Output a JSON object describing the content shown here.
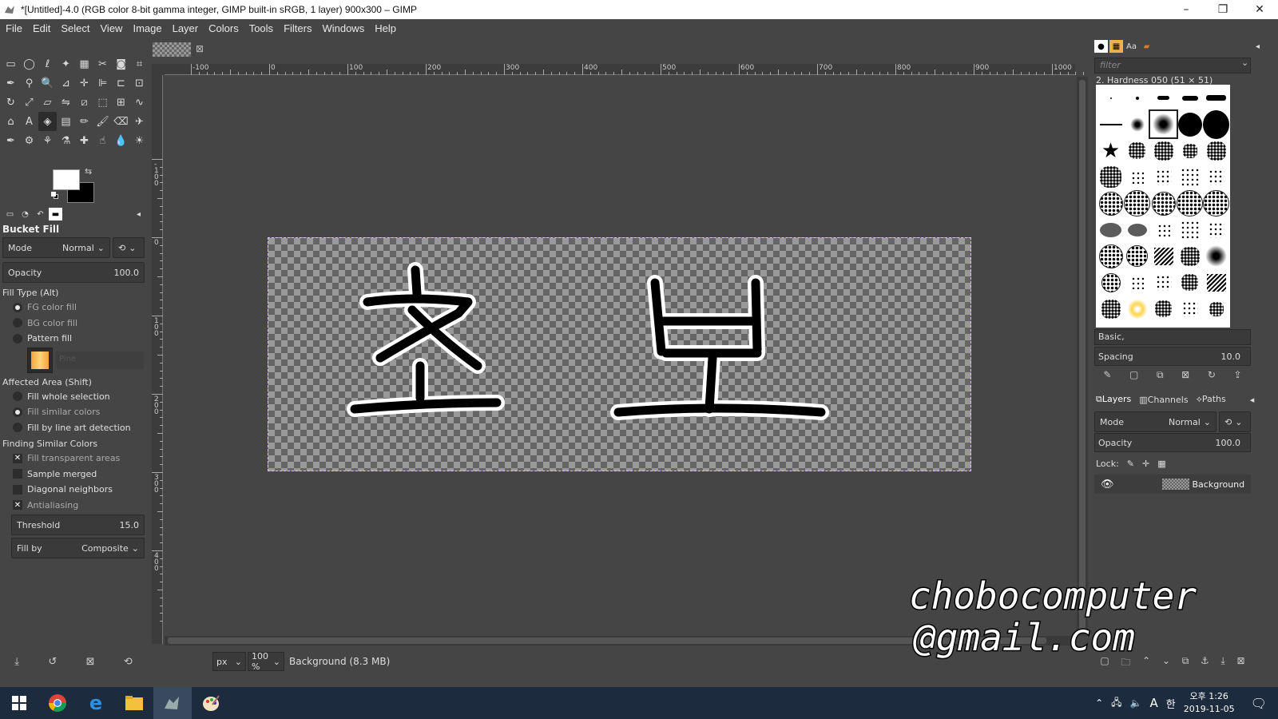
{
  "window": {
    "title": "*[Untitled]-4.0 (RGB color 8-bit gamma integer, GIMP built-in sRGB, 1 layer) 900x300 – GIMP",
    "minimize": "–",
    "maximize": "❐",
    "close": "✕"
  },
  "menu": [
    "File",
    "Edit",
    "Select",
    "View",
    "Image",
    "Layer",
    "Colors",
    "Tools",
    "Filters",
    "Windows",
    "Help"
  ],
  "toolbox": {
    "tools": [
      "rect-select",
      "ellipse-select",
      "free-select",
      "fuzzy-select",
      "by-color-select",
      "scissors-select",
      "foreground-select",
      "crop",
      "paths",
      "color-picker",
      "zoom",
      "measure",
      "move",
      "align",
      "crop-alt",
      "unified-transform",
      "rotate",
      "scale",
      "shear",
      "flip",
      "perspective",
      "3d-transform",
      "handle-transform",
      "warp",
      "cage",
      "text",
      "bucket-fill",
      "gradient",
      "pencil",
      "paintbrush",
      "eraser",
      "airbrush",
      "ink",
      "mypaint-brush",
      "clone",
      "perspective-clone",
      "heal",
      "smudge",
      "blur",
      "dodge-burn"
    ],
    "active_tool": "bucket-fill",
    "fg_color": "#ffffff",
    "bg_color": "#000000"
  },
  "tool_options": {
    "title": "Bucket Fill",
    "mode_label": "Mode",
    "mode_value": "Normal",
    "opacity_label": "Opacity",
    "opacity_value": "100.0",
    "fill_type_label": "Fill Type  (Alt)",
    "fill_type_options": [
      "FG color fill",
      "BG color fill",
      "Pattern fill"
    ],
    "pattern_name": "Pine",
    "affected_area_label": "Affected Area  (Shift)",
    "affected_area_options": [
      "Fill whole selection",
      "Fill similar colors",
      "Fill by line art detection"
    ],
    "similar_label": "Finding Similar Colors",
    "similar_options": [
      "Fill transparent areas",
      "Sample merged",
      "Diagonal neighbors",
      "Antialiasing"
    ],
    "threshold_label": "Threshold",
    "threshold_value": "15.0",
    "fillby_label": "Fill by",
    "fillby_value": "Composite"
  },
  "ruler_top_labels": [
    "-100",
    "0",
    "100",
    "200",
    "300",
    "400",
    "500",
    "600",
    "700",
    "800",
    "900",
    "1000"
  ],
  "ruler_left_labels": [
    "-100",
    "0",
    "100",
    "200",
    "300",
    "400"
  ],
  "statusbar": {
    "unit": "px",
    "zoom": "100 %",
    "text": "Background (8.3 MB)"
  },
  "brushes": {
    "filter_placeholder": "filter",
    "selected_name": "2. Hardness 050 (51 × 51)",
    "set_name": "Basic,",
    "spacing_label": "Spacing",
    "spacing_value": "10.0"
  },
  "layers": {
    "tabs": [
      "Layers",
      "Channels",
      "Paths"
    ],
    "mode_label": "Mode",
    "mode_value": "Normal",
    "opacity_label": "Opacity",
    "opacity_value": "100.0",
    "lock_label": "Lock:",
    "items": [
      {
        "name": "Background"
      }
    ]
  },
  "taskbar": {
    "ime_letter": "A",
    "ime_mode": "한",
    "time": "오후 1:26",
    "date": "2019-11-05"
  },
  "watermark": {
    "line1": "chobocomputer",
    "line2": "@gmail.com"
  }
}
